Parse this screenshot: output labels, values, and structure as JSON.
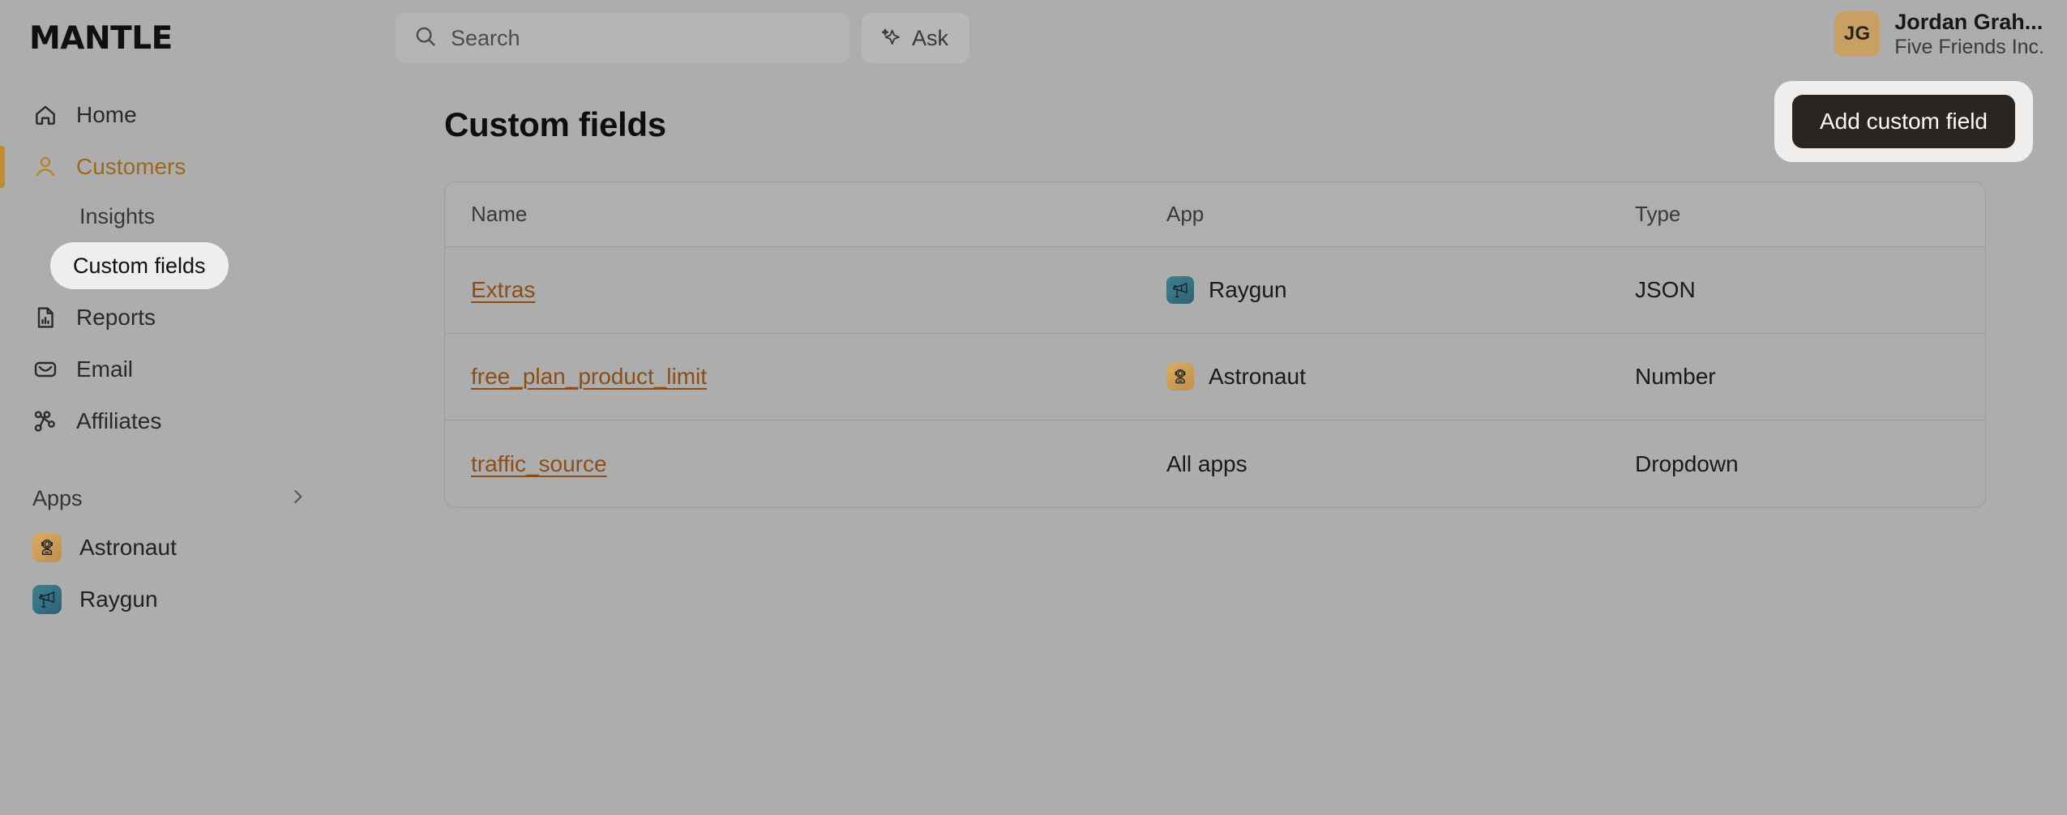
{
  "brand": {
    "logo_text": "MANTLE"
  },
  "search": {
    "placeholder": "Search",
    "icon": "search-icon"
  },
  "ask": {
    "label": "Ask",
    "icon": "sparkle-icon"
  },
  "user": {
    "initials": "JG",
    "name": "Jordan Grah...",
    "organization": "Five Friends Inc.",
    "avatar_color": "#c9a063"
  },
  "sidebar": {
    "items": [
      {
        "label": "Home",
        "icon": "home-icon",
        "active": false
      },
      {
        "label": "Customers",
        "icon": "user-icon",
        "active": true
      },
      {
        "label": "Reports",
        "icon": "report-icon",
        "active": false
      },
      {
        "label": "Email",
        "icon": "envelope-icon",
        "active": false
      },
      {
        "label": "Affiliates",
        "icon": "affiliates-icon",
        "active": false
      }
    ],
    "customers_subitems": [
      {
        "label": "Insights",
        "selected": false
      },
      {
        "label": "Custom fields",
        "selected": true
      }
    ],
    "apps_section": {
      "title": "Apps",
      "chevron": "chevron-right-icon",
      "apps": [
        {
          "label": "Astronaut",
          "icon": "astronaut-app-icon",
          "color": "#c9a063"
        },
        {
          "label": "Raygun",
          "icon": "raygun-app-icon",
          "color": "#34707f"
        }
      ]
    },
    "active_accent_color": "#c08c2e"
  },
  "main": {
    "page_title": "Custom fields",
    "table": {
      "columns": [
        "Name",
        "App",
        "Type"
      ],
      "rows": [
        {
          "name": "Extras",
          "app": "Raygun",
          "app_icon": "raygun-app-icon",
          "type": "JSON"
        },
        {
          "name": "free_plan_product_limit",
          "app": "Astronaut",
          "app_icon": "astronaut-app-icon",
          "type": "Number"
        },
        {
          "name": "traffic_source",
          "app": "All apps",
          "app_icon": null,
          "type": "Dropdown"
        }
      ]
    }
  },
  "actions": {
    "add_custom_field_label": "Add custom field",
    "add_button_bg": "#2b2521",
    "highlight_bg": "#efeeec"
  }
}
